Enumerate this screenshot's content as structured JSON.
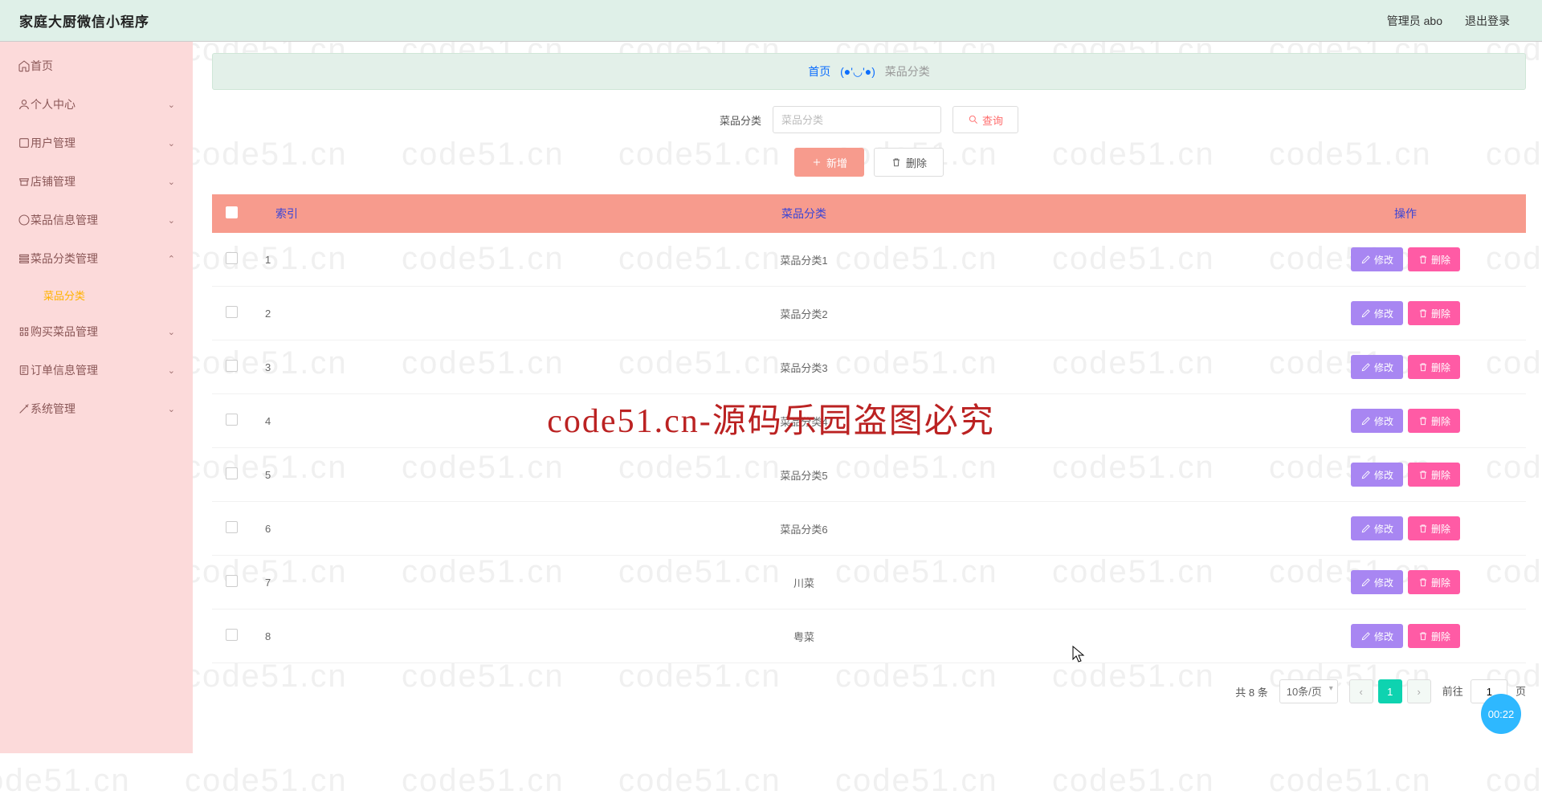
{
  "topbar": {
    "title": "家庭大厨微信小程序",
    "user_label": "管理员 abo",
    "logout": "退出登录"
  },
  "sidebar": {
    "items": [
      {
        "label": "首页"
      },
      {
        "label": "个人中心"
      },
      {
        "label": "用户管理"
      },
      {
        "label": "店铺管理"
      },
      {
        "label": "菜品信息管理"
      },
      {
        "label": "菜品分类管理"
      },
      {
        "label": "购买菜品管理"
      },
      {
        "label": "订单信息管理"
      },
      {
        "label": "系统管理"
      }
    ],
    "sub_active": "菜品分类"
  },
  "breadcrumb": {
    "home": "首页",
    "emoji": "(●'◡'●)",
    "current": "菜品分类"
  },
  "filter": {
    "label": "菜品分类",
    "placeholder": "菜品分类",
    "search": "查询"
  },
  "actions": {
    "add": "新增",
    "delete": "删除"
  },
  "table": {
    "headers": {
      "index": "索引",
      "name": "菜品分类",
      "ops": "操作"
    },
    "edit": "修改",
    "delete": "删除",
    "rows": [
      {
        "idx": "1",
        "name": "菜品分类1"
      },
      {
        "idx": "2",
        "name": "菜品分类2"
      },
      {
        "idx": "3",
        "name": "菜品分类3"
      },
      {
        "idx": "4",
        "name": "菜品分类4"
      },
      {
        "idx": "5",
        "name": "菜品分类5"
      },
      {
        "idx": "6",
        "name": "菜品分类6"
      },
      {
        "idx": "7",
        "name": "川菜"
      },
      {
        "idx": "8",
        "name": "粤菜"
      }
    ]
  },
  "pager": {
    "total": "共 8 条",
    "page_size": "10条/页",
    "current": "1",
    "goto_prefix": "前往",
    "goto_value": "1",
    "goto_suffix": "页"
  },
  "watermark_text": "code51.cn",
  "redstamp": "code51.cn-源码乐园盗图必究",
  "timer": "00:22"
}
